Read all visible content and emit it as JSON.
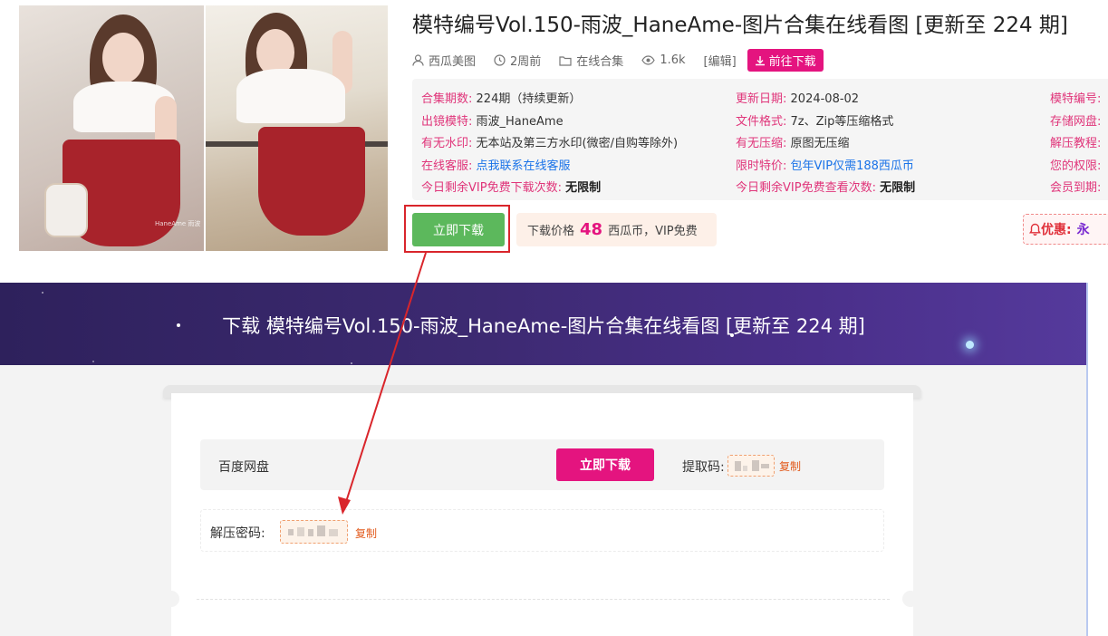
{
  "post": {
    "title": "模特编号Vol.150-雨波_HaneAme-图片合集在线看图 [更新至 224 期]",
    "meta": {
      "author": "西瓜美图",
      "time": "2周前",
      "category": "在线合集",
      "views": "1.6k",
      "edit": "[编辑]",
      "download_label": "前往下载"
    }
  },
  "photos": {
    "watermark": "HaneAme 雨波"
  },
  "info": {
    "col1": [
      {
        "label": "合集期数:",
        "value": "224期（持续更新）"
      },
      {
        "label": "出镜模特:",
        "value": "雨波_HaneAme"
      },
      {
        "label": "有无水印:",
        "value": "无本站及第三方水印(微密/自购等除外)"
      },
      {
        "label": "在线客服:",
        "value": "点我联系在线客服"
      },
      {
        "label": "今日剩余VIP免费下载次数:",
        "value": "无限制"
      }
    ],
    "col2": [
      {
        "label": "更新日期:",
        "value": "2024-08-02"
      },
      {
        "label": "文件格式:",
        "value": "7z、Zip等压缩格式"
      },
      {
        "label": "有无压缩:",
        "value": "原图无压缩"
      },
      {
        "label": "限时特价:",
        "value": "包年VIP仅需188西瓜币"
      },
      {
        "label": "今日剩余VIP免费查看次数:",
        "value": "无限制"
      }
    ],
    "col3": [
      {
        "label": "模特编号:"
      },
      {
        "label": "存储网盘:"
      },
      {
        "label": "解压教程:"
      },
      {
        "label": "您的权限:"
      },
      {
        "label": "会员到期:"
      }
    ]
  },
  "purchase": {
    "buy_label": "立即下载",
    "price_prefix": "下载价格",
    "price_value": "48",
    "price_suffix": "西瓜币，VIP免费",
    "promo_label": "优惠:",
    "promo_value": "永"
  },
  "download_panel": {
    "title": "下载 模特编号Vol.150-雨波_HaneAme-图片合集在线看图 [更新至 224 期]",
    "disk_name": "百度网盘",
    "download_label": "立即下载",
    "code_label": "提取码:",
    "copy_label": "复制",
    "password_label": "解压密码:",
    "copy_label_2": "复制"
  },
  "colors": {
    "accent": "#e4147f",
    "label_pink": "#e0357a",
    "buy_green": "#5cb85c",
    "annotation_red": "#d9252b",
    "banner_start": "#2e215c",
    "banner_end": "#553a9c"
  }
}
